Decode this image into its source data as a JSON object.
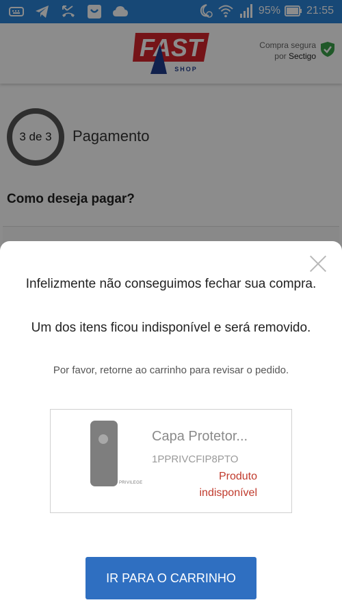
{
  "status_bar": {
    "battery": "95%",
    "time": "21:55",
    "left_icons": [
      "keyboard-icon",
      "telegram-icon",
      "missed-call-icon",
      "shopping-bag-icon",
      "cloud-icon"
    ],
    "right_icons": [
      "do-not-disturb-icon",
      "wifi-icon",
      "signal-icon",
      "battery-icon"
    ]
  },
  "header": {
    "logo_main": "FAST",
    "logo_sub": "SHOP",
    "secure_line1": "Compra segura",
    "secure_line2_prefix": "por ",
    "secure_line2_brand": "Sectigo"
  },
  "checkout": {
    "progress": "3 de 3",
    "step_title": "Pagamento",
    "question": "Como deseja pagar?"
  },
  "modal": {
    "message_line1": "Infelizmente não conseguimos fechar sua compra.",
    "message_line2": "Um dos itens ficou indisponível e será removido.",
    "message_line3": "Por favor, retorne ao carrinho para revisar o pedido.",
    "product": {
      "name": "Capa Protetor...",
      "sku": "1PPRIVCFIP8PTO",
      "status": "Produto indisponível",
      "image_brand": "PRIVILEGE"
    },
    "button_label": "IR PARA O CARRINHO"
  },
  "colors": {
    "status_bar": "#2a83d8",
    "logo_red": "#d6252c",
    "logo_blue": "#1f3c8c",
    "shield_green": "#3aa14a",
    "button_blue": "#2f6fc1",
    "error_red": "#c0392b"
  }
}
